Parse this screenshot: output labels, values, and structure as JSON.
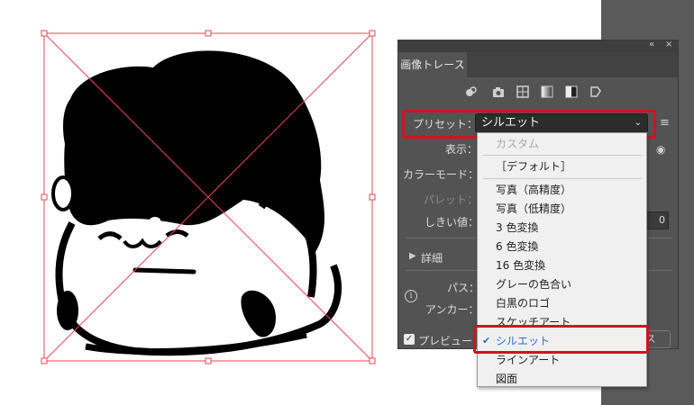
{
  "panel": {
    "title": "画像トレース",
    "preset_label": "プリセット：",
    "preset_value": "シルエット",
    "view_label": "表示：",
    "color_mode_label": "カラーモード：",
    "palette_label": "パレット：",
    "threshold_label": "しきい値：",
    "threshold_value": "0",
    "detail_label": "詳細",
    "paths_label": "パス：",
    "anchors_label": "アンカー：",
    "preview_label": "プレビュー",
    "trace_button": "ス",
    "collapse_icon": "«",
    "close_icon": "×",
    "accent_highlight": "#d1141b"
  },
  "preset_menu": {
    "items": [
      {
        "label": "カスタム",
        "state": "disabled"
      },
      {
        "label": "［デフォルト］",
        "state": "normal"
      },
      {
        "label": "写真（高精度）",
        "state": "normal"
      },
      {
        "label": "写真（低精度）",
        "state": "normal"
      },
      {
        "label": "3 色変換",
        "state": "normal"
      },
      {
        "label": "6 色変換",
        "state": "normal"
      },
      {
        "label": "16 色変換",
        "state": "normal"
      },
      {
        "label": "グレーの色合い",
        "state": "normal"
      },
      {
        "label": "白黒のロゴ",
        "state": "normal"
      },
      {
        "label": "スケッチアート",
        "state": "normal"
      },
      {
        "label": "シルエット",
        "state": "selected"
      },
      {
        "label": "ラインアート",
        "state": "normal"
      },
      {
        "label": "図面",
        "state": "normal"
      }
    ]
  }
}
